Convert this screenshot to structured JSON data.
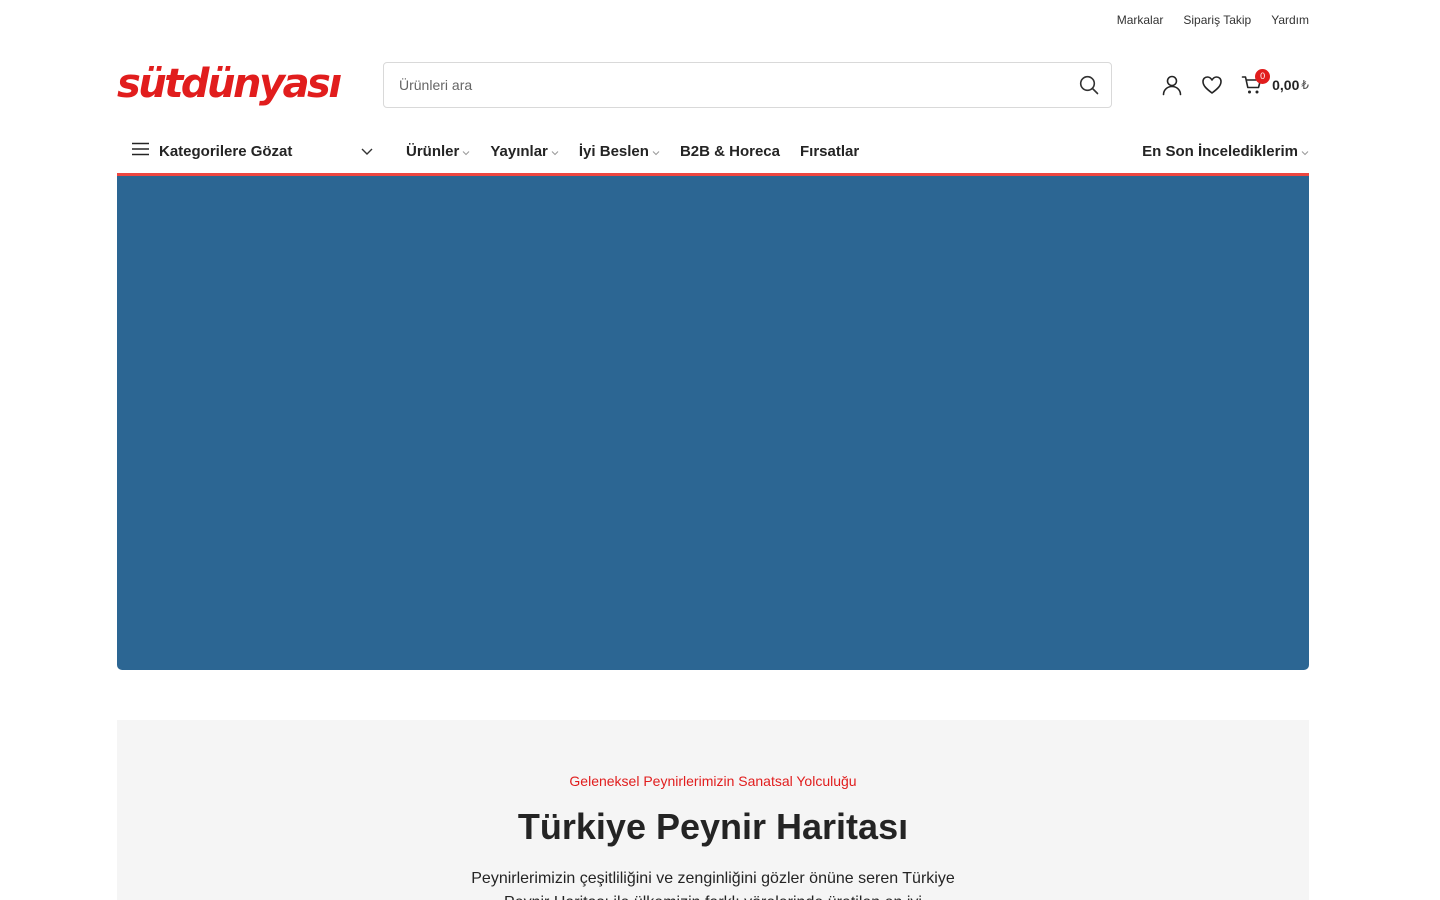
{
  "topbar": {
    "links": [
      "Markalar",
      "Sipariş Takip",
      "Yardım"
    ]
  },
  "header": {
    "logo_text": "sütdünyası",
    "search_placeholder": "Ürünleri ara",
    "cart_count": "0",
    "cart_amount": "0,00",
    "currency_symbol": "₺"
  },
  "nav": {
    "categories_label": "Kategorilere Gözat",
    "menu": [
      "Ürünler",
      "Yayınlar",
      "İyi Beslen",
      "B2B & Horeca",
      "Fırsatlar"
    ],
    "recent_label": "En Son İncelediklerim"
  },
  "colors": {
    "brand_red": "#e11d1d",
    "nav_underline": "#ee4640",
    "hero_blue": "#2c6693",
    "promo_bg": "#f5f5f5"
  },
  "promo": {
    "subtitle": "Geleneksel Peynirlerimizin Sanatsal Yolculuğu",
    "title": "Türkiye Peynir Haritası",
    "description": "Peynirlerimizin çeşitliliğini ve zenginliğini gözler önüne seren Türkiye Peynir Haritası ile ülkemizin farklı yörelerinde üretilen en iyi"
  }
}
